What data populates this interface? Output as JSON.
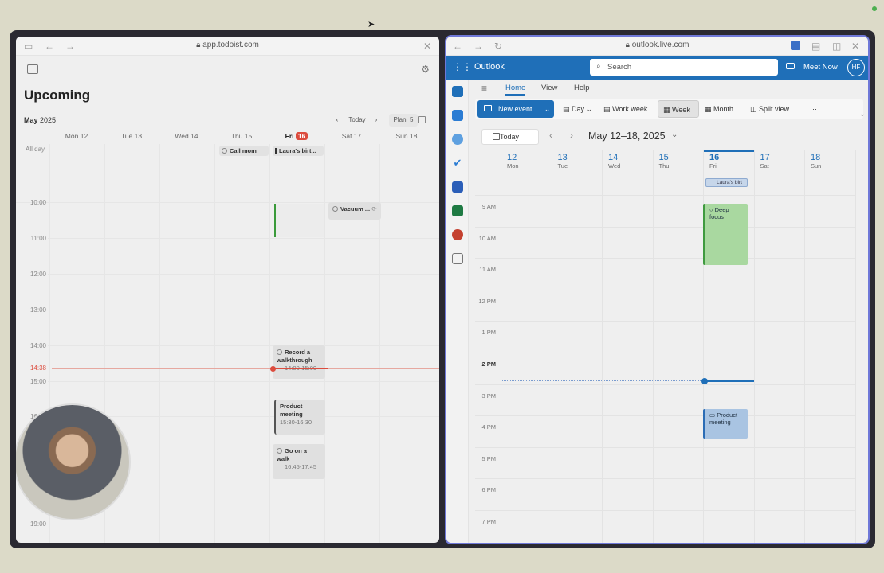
{
  "left": {
    "url": "app.todoist.com",
    "title": "Upcoming",
    "month": "May",
    "year": "2025",
    "today_btn": "Today",
    "plan_btn": "Plan: 5",
    "all_day": "All day",
    "days": [
      {
        "name": "Mon",
        "num": "12"
      },
      {
        "name": "Tue",
        "num": "13"
      },
      {
        "name": "Wed",
        "num": "14"
      },
      {
        "name": "Thu",
        "num": "15"
      },
      {
        "name": "Fri",
        "num": "16"
      },
      {
        "name": "Sat",
        "num": "17"
      },
      {
        "name": "Sun",
        "num": "18"
      }
    ],
    "times": [
      "10:00",
      "11:00",
      "12:00",
      "13:00",
      "14:00",
      "15:00",
      "16:00",
      "19:00"
    ],
    "now": "14:38",
    "allday_chips": [
      "Call mom",
      "Laura's birt..."
    ],
    "events": [
      {
        "title": "Vacuum ...",
        "time": ""
      },
      {
        "title": "Record a walkthrough",
        "time": "14:00-15:00"
      },
      {
        "title": "Product meeting",
        "time": "15:30-16:30"
      },
      {
        "title": "Go on a walk",
        "time": "16:45-17:45"
      }
    ]
  },
  "right": {
    "url": "outlook.live.com",
    "app": "Outlook",
    "search_placeholder": "Search",
    "meet_now": "Meet Now",
    "avatar": "HF",
    "tabs": [
      "Home",
      "View",
      "Help"
    ],
    "ribbon": {
      "new_event": "New event",
      "day": "Day",
      "work_week": "Work week",
      "week": "Week",
      "month": "Month",
      "split_view": "Split view",
      "more": "···"
    },
    "today_btn": "Today",
    "range": "May 12–18, 2025",
    "days": [
      {
        "num": "12",
        "name": "Mon"
      },
      {
        "num": "13",
        "name": "Tue"
      },
      {
        "num": "14",
        "name": "Wed"
      },
      {
        "num": "15",
        "name": "Thu"
      },
      {
        "num": "16",
        "name": "Fri"
      },
      {
        "num": "17",
        "name": "Sat"
      },
      {
        "num": "18",
        "name": "Sun"
      }
    ],
    "allday_event": "Laura's birt",
    "times": [
      "9 AM",
      "10 AM",
      "11 AM",
      "12 PM",
      "1 PM",
      "2 PM",
      "3 PM",
      "4 PM",
      "5 PM",
      "6 PM",
      "7 PM"
    ],
    "events": [
      {
        "title": "Deep focus"
      },
      {
        "title": "Product meeting"
      }
    ]
  },
  "colors": {
    "outlook_blue": "#1f6fb8",
    "todoist_red": "#dc4c3e",
    "focus_green": "#a9d8a0",
    "meeting_blue": "#a9c4e2"
  }
}
